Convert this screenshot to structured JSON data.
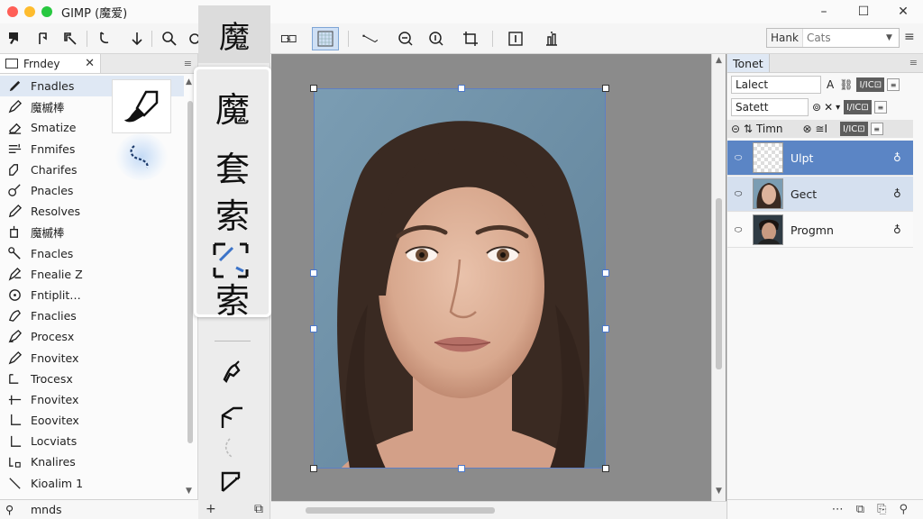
{
  "window": {
    "title": "GIMP (魔爱)",
    "controls": [
      "–",
      "☐",
      "✕"
    ],
    "traffic_colors": [
      "#ff5f57",
      "#febc2e",
      "#28c840"
    ]
  },
  "toolbar": {
    "buttons": [
      "select-icon",
      "redo-icon",
      "rotate-icon",
      "lasso-icon",
      "arrow-down-icon",
      "zoom-icon",
      "zoom-fit-icon",
      "transform-icon",
      "checker-icon",
      "path-icon",
      "zoom-out-icon",
      "zoom-in-icon",
      "crop-icon",
      "text-icon",
      "align-icon"
    ],
    "mode_label": "Hank",
    "mode_value": "Cats",
    "more": "≡"
  },
  "tools_panel": {
    "tab_label": "Frndey",
    "tab_close": "✕",
    "menu": "≡",
    "items": [
      {
        "label": "Fnadles",
        "icon": "brush-icon",
        "selected": true
      },
      {
        "label": "魔槭棒",
        "icon": "pen-icon"
      },
      {
        "label": "Smatize",
        "icon": "eraser-icon"
      },
      {
        "label": "Fnmifes",
        "icon": "blend-icon"
      },
      {
        "label": "Charifes",
        "icon": "heal-icon"
      },
      {
        "label": "Pnacles",
        "icon": "clone-icon"
      },
      {
        "label": "Resolves",
        "icon": "pencil-icon"
      },
      {
        "label": "魔槭棒",
        "icon": "bucket-icon"
      },
      {
        "label": "Fnacles",
        "icon": "smudge-icon"
      },
      {
        "label": "Fnealie Z",
        "icon": "dodge-icon"
      },
      {
        "label": "Fntiplit…",
        "icon": "measure-icon"
      },
      {
        "label": "Fnaclies",
        "icon": "warp-icon"
      },
      {
        "label": "Procesx",
        "icon": "ink-icon"
      },
      {
        "label": "Fnovitex",
        "icon": "airbrush-icon"
      },
      {
        "label": "Trocesx",
        "icon": "path-tool-icon"
      },
      {
        "label": "Fnovitex",
        "icon": "align-tool-icon"
      },
      {
        "label": "Eoovitex",
        "icon": "corner-icon"
      },
      {
        "label": "Locviats",
        "icon": "line-icon"
      },
      {
        "label": "Knalires",
        "icon": "perspective-icon"
      },
      {
        "label": "Kioalim 1",
        "icon": "scale-icon"
      }
    ],
    "footer_label": "mnds",
    "footer_icon": "search-icon"
  },
  "toolbox": {
    "top_glyph": "魔",
    "popup_glyphs": [
      "魔",
      "套",
      "索",
      "索"
    ],
    "bottom_left": "+",
    "bottom_right": "⧉"
  },
  "layers_panel": {
    "tab_label": "Tonet",
    "menu": "≡",
    "row1_label": "Lalect",
    "row1_badge": "I/IC⊡",
    "row2_label": "Satett",
    "row2_badge": "I/IC⊡",
    "row3_label": "Timn",
    "row3_prefix": "⊝ ⇅",
    "row3_mid": "⊗ ≅I",
    "row3_badge": "I/IC⊡",
    "layers": [
      {
        "name": "Ulpt",
        "selected": true,
        "thumb": "checker"
      },
      {
        "name": "Gect",
        "selected": false,
        "thumb": "face"
      },
      {
        "name": "Progmn",
        "selected": false,
        "thumb": "face-dark"
      }
    ],
    "footer_icons": [
      "dots-icon",
      "layer-icon",
      "dup-icon",
      "pin-icon"
    ]
  }
}
